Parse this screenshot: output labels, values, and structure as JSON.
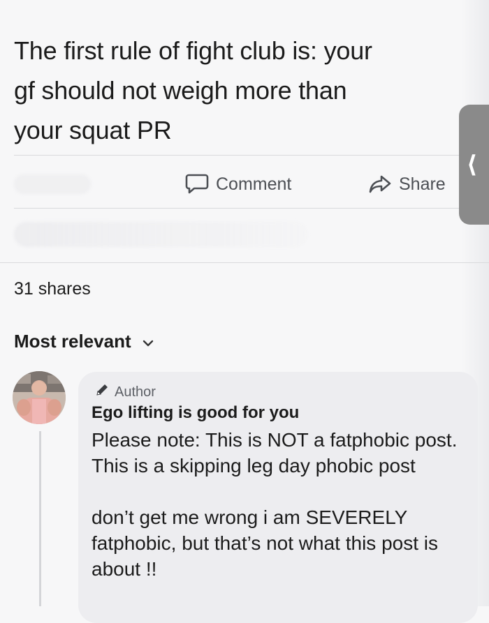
{
  "post": {
    "lines": [
      "The first rule of fight club is: your",
      "gf should not weigh more than",
      "your squat PR"
    ]
  },
  "actions": {
    "comment_label": "Comment",
    "share_label": "Share"
  },
  "stats": {
    "shares": "31 shares"
  },
  "sort": {
    "label": "Most relevant"
  },
  "comment": {
    "badge": "Author",
    "name": "Ego lifting is good for you",
    "paragraphs": [
      "Please note: This is NOT a fatphobic post. This is a skipping leg day phobic post",
      "don’t get me wrong i am SEVERELY fatphobic, but that’s not what this post is about !!"
    ]
  },
  "side_tab": {
    "icon": "chevron-left-icon"
  }
}
